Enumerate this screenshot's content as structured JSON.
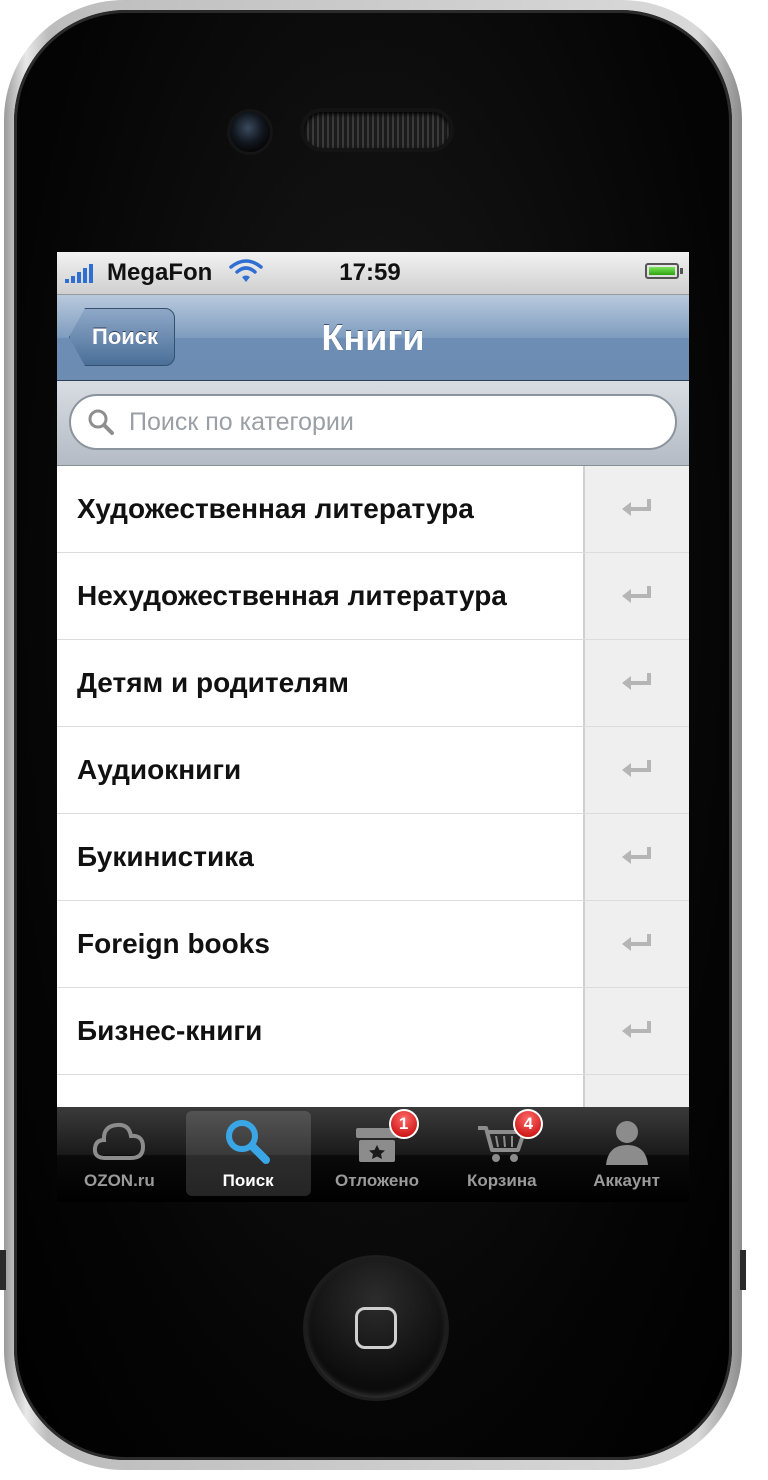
{
  "status_bar": {
    "carrier": "MegaFon",
    "time": "17:59"
  },
  "nav_bar": {
    "back_label": "Поиск",
    "title": "Книги"
  },
  "search": {
    "placeholder": "Поиск по категории"
  },
  "categories": [
    {
      "label": "Художественная литература"
    },
    {
      "label": "Нехудожественная литература"
    },
    {
      "label": "Детям и родителям"
    },
    {
      "label": "Аудиокниги"
    },
    {
      "label": "Букинистика"
    },
    {
      "label": "Foreign books"
    },
    {
      "label": "Бизнес-книги"
    },
    {
      "label": ""
    }
  ],
  "tab_bar": {
    "tabs": [
      {
        "label": "OZON.ru",
        "icon": "cloud-icon"
      },
      {
        "label": "Поиск",
        "icon": "magnifier-icon",
        "active": true
      },
      {
        "label": "Отложено",
        "icon": "archive-box-icon",
        "badge": "1"
      },
      {
        "label": "Корзина",
        "icon": "cart-icon",
        "badge": "4"
      },
      {
        "label": "Аккаунт",
        "icon": "person-icon"
      }
    ]
  },
  "colors": {
    "nav_bar": "#7f9dbf",
    "tab_active_icon": "#3aa6e6",
    "badge": "#d40000",
    "battery": "#3cc21a"
  }
}
